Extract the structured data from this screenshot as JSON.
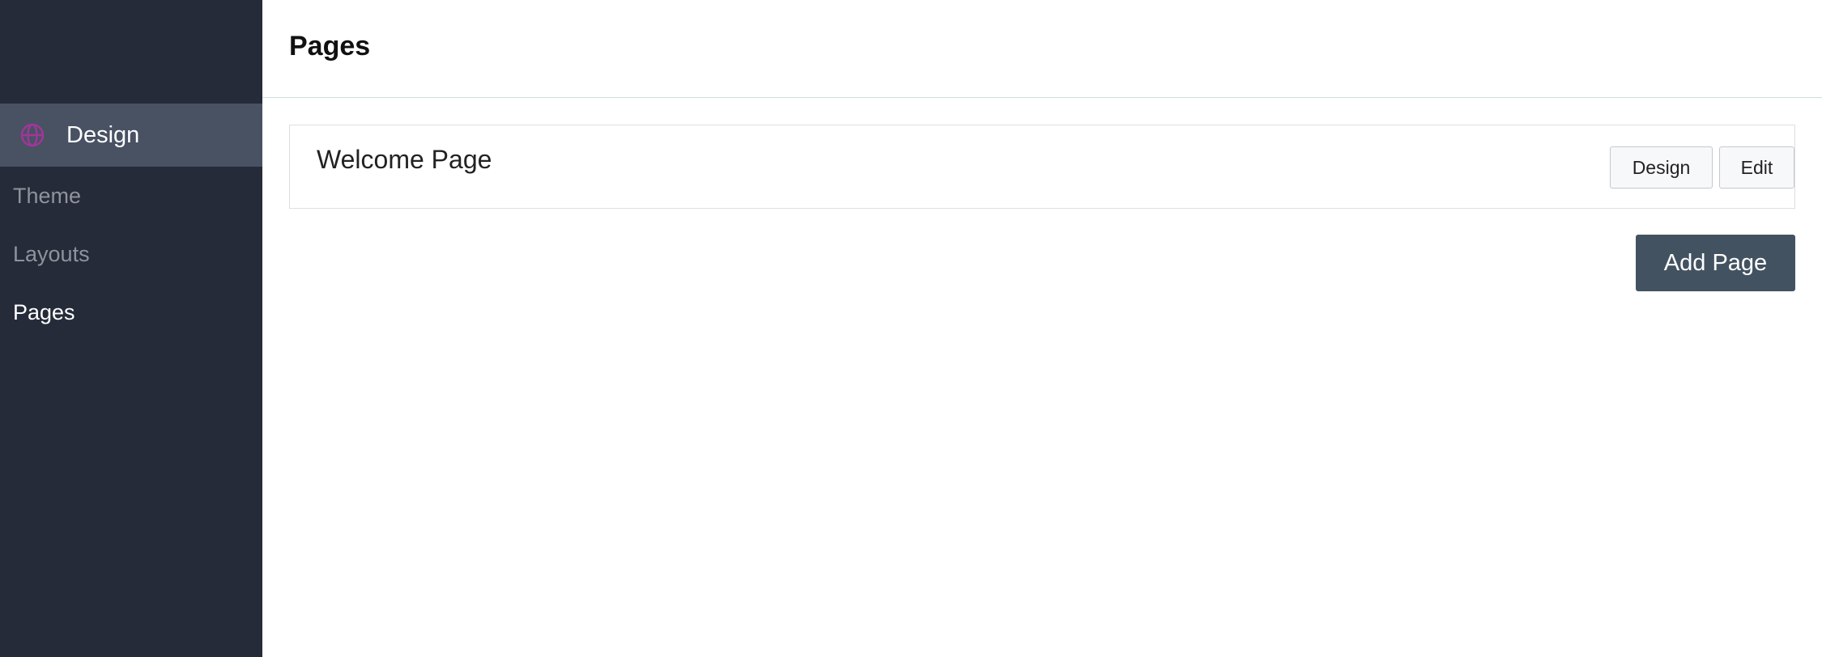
{
  "sidebar": {
    "section": {
      "label": "Design",
      "icon": "globe-icon",
      "icon_color": "#a3359a"
    },
    "items": [
      {
        "label": "Theme",
        "active": false
      },
      {
        "label": "Layouts",
        "active": false
      },
      {
        "label": "Pages",
        "active": true
      }
    ]
  },
  "header": {
    "title": "Pages"
  },
  "pages": [
    {
      "name": "Welcome Page",
      "design_label": "Design",
      "edit_label": "Edit"
    }
  ],
  "actions": {
    "add_page_label": "Add Page"
  },
  "colors": {
    "sidebar_bg": "#252b39",
    "sidebar_active_section_bg": "#485263",
    "primary_button": "#435260"
  }
}
